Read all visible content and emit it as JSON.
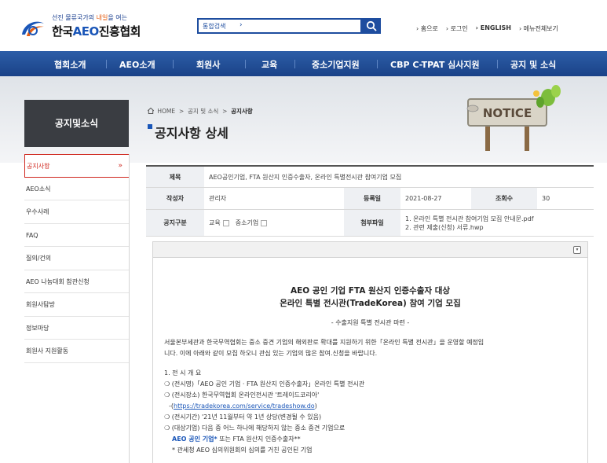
{
  "header": {
    "tagline_before": "선진 물류국가의 ",
    "tagline_highlight": "내일",
    "tagline_after": "을 여는",
    "logo_name_prefix": "한국",
    "logo_name_brand": "AEO",
    "logo_name_suffix": "진흥협회",
    "search": {
      "scope": "통합검색",
      "scope_arrow": "›",
      "value": ""
    },
    "util_links": [
      "› 홈으로",
      "› 로그인",
      "› ENGLISH",
      "› 메뉴전체보기"
    ]
  },
  "gnb": [
    "협회소개",
    "AEO소개",
    "회원사",
    "교육",
    "중소기업지원",
    "CBP C-TPAT 심사지원",
    "공지 및 소식"
  ],
  "sidebar": {
    "title": "공지및소식",
    "active_arrow": "»",
    "items": [
      {
        "label": "공지사항"
      },
      {
        "label": "AEO소식"
      },
      {
        "label": "우수사례"
      },
      {
        "label": "FAQ"
      },
      {
        "label": "질의/건의"
      },
      {
        "label": "AEO 나눔대회 참관신청"
      },
      {
        "label": "회원사탐방"
      },
      {
        "label": "정보마당"
      },
      {
        "label": "회원사 지원활동"
      }
    ]
  },
  "breadcrumb": {
    "home": "HOME",
    "sep": ">",
    "level1": "공지 및 소식",
    "level2": "공지사항"
  },
  "page_title": "공지사항 상세",
  "notice_sign": "NOTICE",
  "detail": {
    "labels": {
      "subject": "제목",
      "author": "작성자",
      "date": "등록일",
      "views": "조회수",
      "category": "공지구분",
      "attachment": "첨부파일"
    },
    "subject": "AEO공인기업, FTA 원산지 인증수출자, 온라인 특별전시관 참여기업 모집",
    "author": "관리자",
    "date": "2021-08-27",
    "views": "30",
    "categories": [
      "교육",
      "중소기업"
    ],
    "attachments": [
      "1. 온라인 특별 전시관 참여기업 모집 안내문.pdf",
      "2. 관련 제출(신청) 서류.hwp"
    ]
  },
  "body": {
    "collapse": "▾",
    "title1": "AEO 공인 기업 FTA 원산지 인증수출자 대상",
    "title2": "온라인 특별 전시관(TradeKorea) 참여 기업 모집",
    "subtitle": "- 수출지원 특별 전시관 마련 -",
    "intro1": "서울본부세관과 한국무역협회는 중소 중견 기업의 해외판로 확대를 지원하기 위한「온라인 특별 전시관」을 운영할 예정입",
    "intro2": "니다. 이에 아래와 같이 모집 하오니 관심 있는 기업의 많은 참여.신청을 바랍니다.",
    "section1": "1. 전 시 개 요",
    "line_name": "❍ (전시명)「AEO 공인 기업 · FTA 원산지 인증수출자」온라인 특별 전시관",
    "line_place": "❍ (전시장소) 한국무역협회 온라인전시관 '트레이드코리아'",
    "line_link_prefix": "-(",
    "line_link": "https://tradekorea.com/service/tradeshow.do",
    "line_link_suffix": ")",
    "line_period": "❍ (전시기간) '21년 11월부터 약 1년 상당(변경될 수 있음)",
    "line_target": "❍ (대상기업) 다음 중 어느 하나에 해당하지 않는 중소 중견 기업으로",
    "line_aeo_em": "AEO 공인 기업*",
    "line_aeo_mid": " 또는 FTA 원산지 인증수출자**",
    "line_note": "* 관세청 AEO 심의위원회의 심의를 거친 공인된 기업"
  }
}
